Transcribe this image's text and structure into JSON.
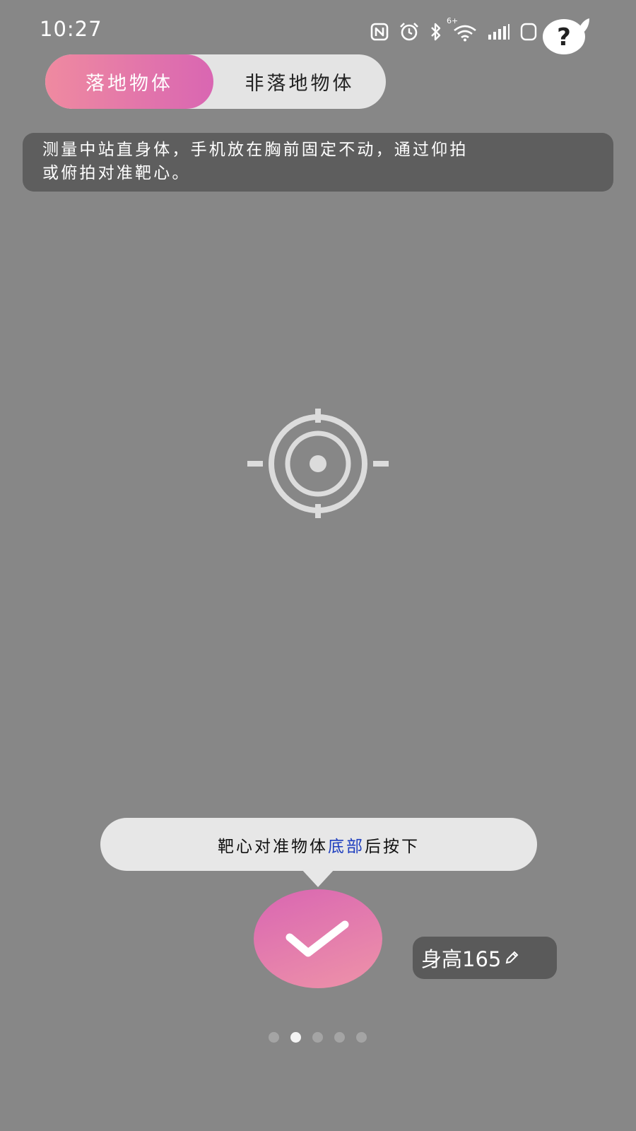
{
  "status_bar": {
    "time": "10:27",
    "icons": [
      "nfc-icon",
      "alarm-icon",
      "bluetooth-icon",
      "wifi-icon",
      "signal-icon",
      "battery-icon"
    ],
    "network_badge": "6+"
  },
  "help": {
    "icon": "question-mark-icon",
    "glyph": "?"
  },
  "mode_toggle": {
    "options": [
      "落地物体",
      "非落地物体"
    ],
    "selected": "落地物体",
    "active_gradient": [
      "#ef8aa0",
      "#d966b2"
    ]
  },
  "instruction": {
    "line1": "测量中站直身体，手机放在胸前固定不动，通过仰拍",
    "line2": "或俯拍对准靶心。"
  },
  "crosshair": {
    "icon": "crosshair-target-icon"
  },
  "tooltip": {
    "prefix": "靶心对准物体",
    "highlight": "底部",
    "suffix": "后按下",
    "highlight_color": "#1f3fbf"
  },
  "confirm": {
    "icon": "check-icon"
  },
  "height_setting": {
    "label": "身高165",
    "icon": "pencil-icon"
  },
  "pager": {
    "count": 5,
    "active_index": 1
  },
  "colors": {
    "background": "#878787",
    "accent_pink": "#d966b2",
    "accent_light_pink": "#ee93a8"
  }
}
